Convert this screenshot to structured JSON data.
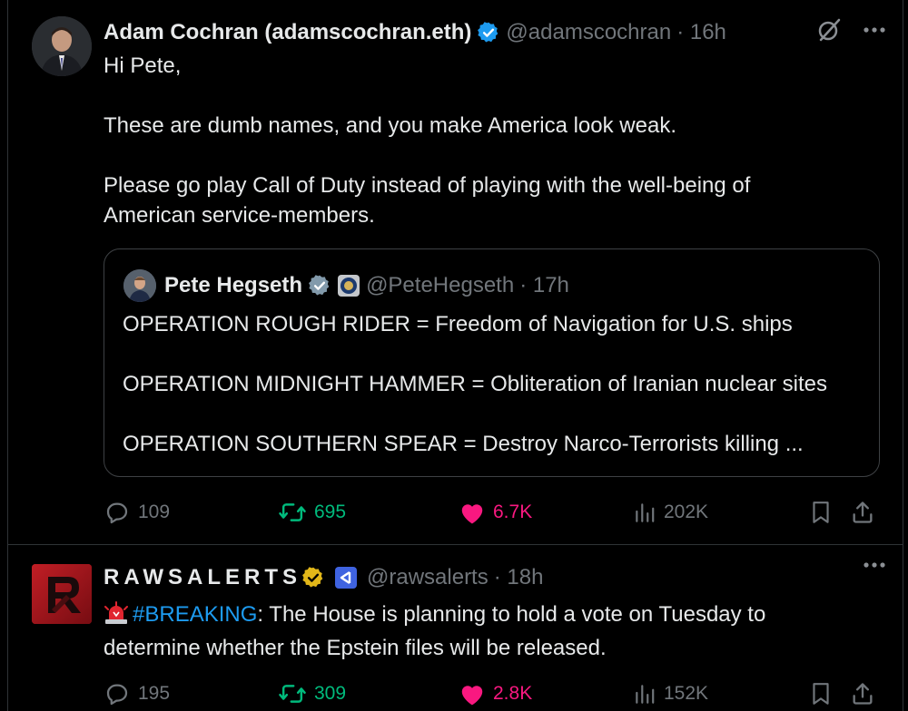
{
  "tweets": [
    {
      "author_name": "Adam Cochran (adamscochran.eth)",
      "handle": "@adamscochran",
      "time": "· 16h",
      "text_lines": [
        "Hi Pete,",
        "These are dumb names, and you make America look weak.",
        "Please go play Call of Duty instead of playing with the well-being of",
        "American service-members."
      ],
      "quote": {
        "author_name": "Pete Hegseth",
        "handle": "@PeteHegseth",
        "time": "· 17h",
        "lines": [
          "OPERATION ROUGH RIDER = Freedom of Navigation for U.S. ships",
          "OPERATION MIDNIGHT HAMMER = Obliteration of Iranian nuclear sites",
          "OPERATION SOUTHERN SPEAR = Destroy Narco-Terrorists killing ..."
        ]
      },
      "stats": {
        "replies": "109",
        "reposts": "695",
        "likes": "6.7K",
        "views": "202K"
      }
    },
    {
      "author_name": "RAWSALERTS",
      "handle": "@rawsalerts",
      "time": "· 18h",
      "hashtag": "#BREAKING",
      "text_after_hashtag": ": The House is planning to hold a vote on Tuesday to",
      "text_line2": "determine whether the Epstein files will be released.",
      "stats": {
        "replies": "195",
        "reposts": "309",
        "likes": "2.8K",
        "views": "152K"
      }
    }
  ],
  "colors": {
    "background": "#000000",
    "text": "#e7e9ea",
    "muted": "#71767b",
    "link": "#1d9bf0",
    "repost": "#00ba7c",
    "like": "#f91880",
    "verified_blue": "#1d9bf0",
    "verified_gold": "#e2b719"
  },
  "icons": [
    "verified-badge-icon",
    "grok-icon",
    "more-icon",
    "reply-icon",
    "repost-icon",
    "like-icon",
    "views-icon",
    "bookmark-icon",
    "share-icon",
    "siren-emoji-icon",
    "government-badge-icon",
    "affiliate-badge-icon"
  ]
}
